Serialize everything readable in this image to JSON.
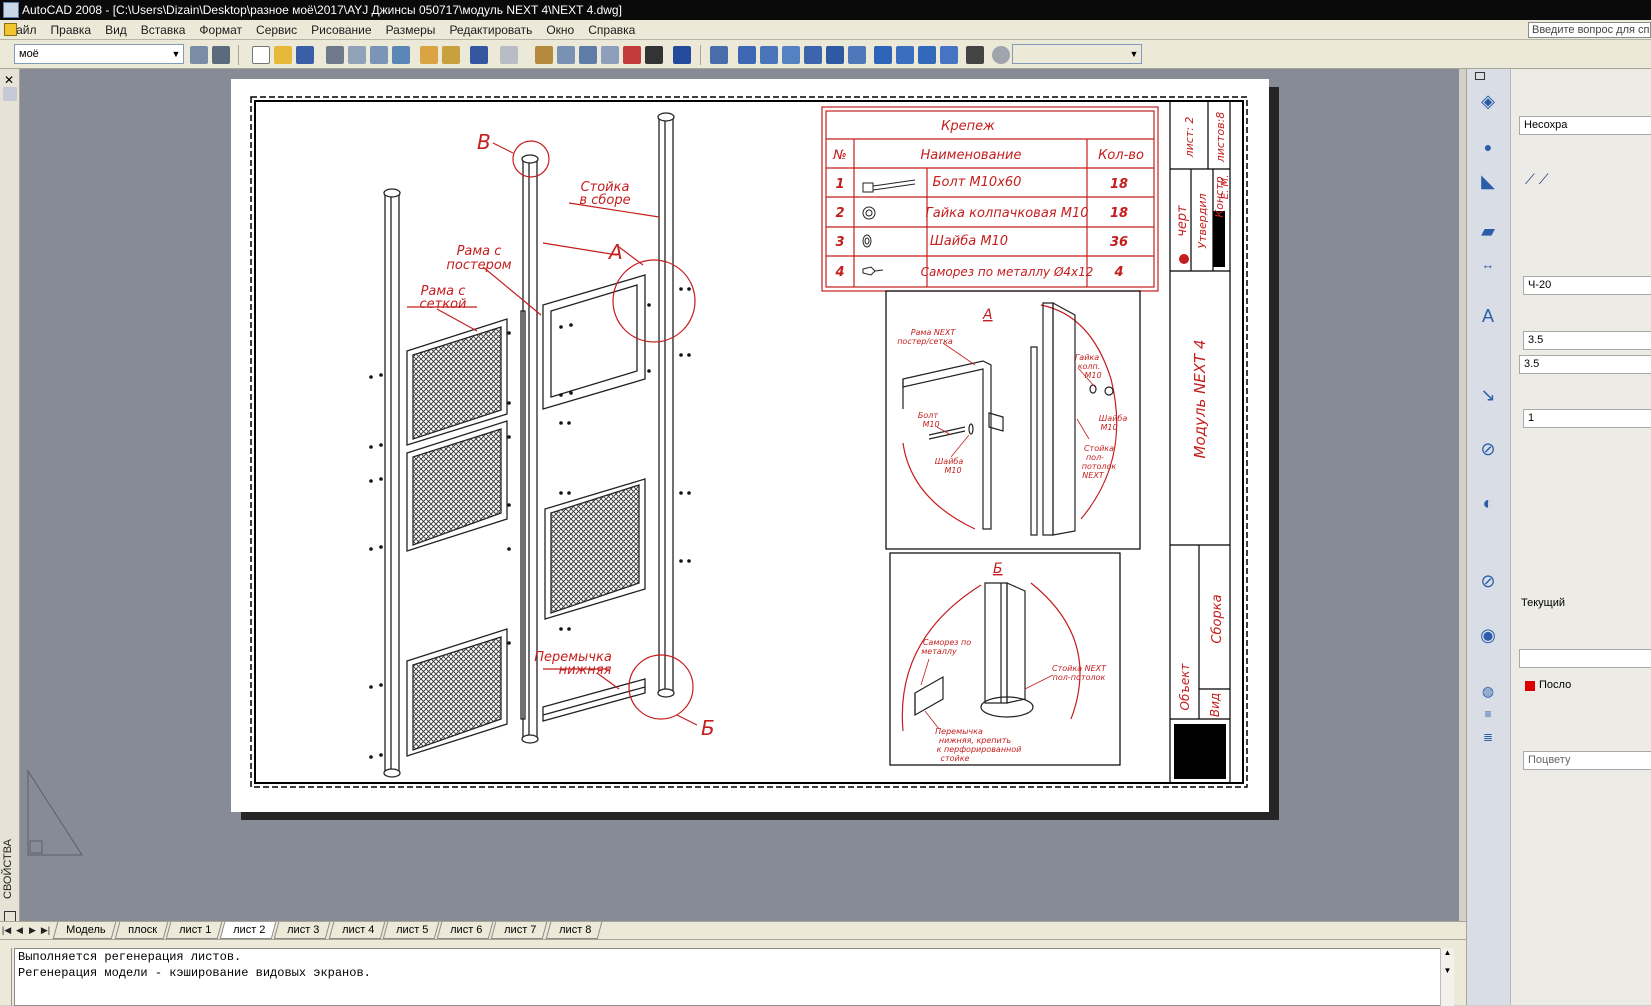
{
  "window": {
    "title": "AutoCAD 2008 - [C:\\Users\\Dizain\\Desktop\\разное моё\\2017\\AYJ Джинсы 050717\\модуль NEXT 4\\NEXT 4.dwg]"
  },
  "menu": {
    "items": [
      "Файл",
      "Правка",
      "Вид",
      "Вставка",
      "Формат",
      "Сервис",
      "Рисование",
      "Размеры",
      "Редактировать",
      "Окно",
      "Справка"
    ],
    "help_placeholder": "Введите вопрос для спр"
  },
  "toolbar": {
    "workspace_value": "моё"
  },
  "left_palette": {
    "label": "СВОЙСТВА"
  },
  "drawing": {
    "callout_v": "B",
    "callout_a": "A",
    "callout_b": "Б",
    "label_stand": [
      "Стойка",
      "в сборе"
    ],
    "label_poster_frame": [
      "Рама с",
      "постером"
    ],
    "label_mesh_frame": [
      "Рама с",
      "сеткой"
    ],
    "label_bottom_bar": [
      "Перемычка",
      "нижняя"
    ],
    "fasteners": {
      "title": "Крепеж",
      "col_no": "№",
      "col_name": "Наименование",
      "col_qty": "Кол-во",
      "rows": [
        {
          "no": "1",
          "name": "Болт М10х60",
          "qty": "18"
        },
        {
          "no": "2",
          "name": "Гайка колпачковая М10",
          "qty": "18"
        },
        {
          "no": "3",
          "name": "Шайба М10",
          "qty": "36"
        },
        {
          "no": "4",
          "name": "Саморез по металлу Ø4х12",
          "qty": "4"
        }
      ]
    },
    "detail_a": {
      "title": "А",
      "lbl_frame": [
        "Рама NEXT",
        "постер/сетка"
      ],
      "lbl_bolt": [
        "Болт",
        "М10"
      ],
      "lbl_washer1": [
        "Шайба",
        "М10"
      ],
      "lbl_nut": [
        "Гайка",
        "колп.",
        "М10"
      ],
      "lbl_washer2": [
        "Шайба",
        "М10"
      ],
      "lbl_stand": [
        "Стойка",
        "пол-",
        "потолок",
        "NEXT"
      ]
    },
    "detail_b": {
      "title": "Б",
      "lbl_screw": [
        "Саморез по",
        "металлу"
      ],
      "lbl_stand": [
        "Стойка NEXT",
        "пол-потолок"
      ],
      "lbl_bar": [
        "Перемычка",
        "нижняя, крепить",
        "к перфорированной",
        "стойке"
      ]
    },
    "stamp": {
      "sheet": "лист: 2",
      "sheets": "листов:8",
      "draw": "черт",
      "approved": "Утвердил",
      "constr": "Констр",
      "author": "Е. М.",
      "title": "Модуль NEXT 4",
      "assembly": "Сборка",
      "object": "Объект",
      "view": "Вид"
    }
  },
  "right_panel": {
    "layer_value": "Несохра",
    "dim_value": "Ч-20",
    "text_height1": "3.5",
    "text_height2": "3.5",
    "scale_value": "1",
    "current_label": "Текущий",
    "color_value": "Посло",
    "plot_style": "Поцвету"
  },
  "layout_tabs": [
    "Модель",
    "плоск",
    "лист 1",
    "лист 2",
    "лист 3",
    "лист 4",
    "лист 5",
    "лист 6",
    "лист 7",
    "лист 8"
  ],
  "active_tab": "лист 2",
  "command_line": {
    "lines": [
      "Выполняется регенерация листов.",
      "Регенерация модели - кэширование видовых экранов."
    ]
  },
  "colors": {
    "accent_red": "#c41e1e",
    "canvas_bg": "#878b95"
  }
}
